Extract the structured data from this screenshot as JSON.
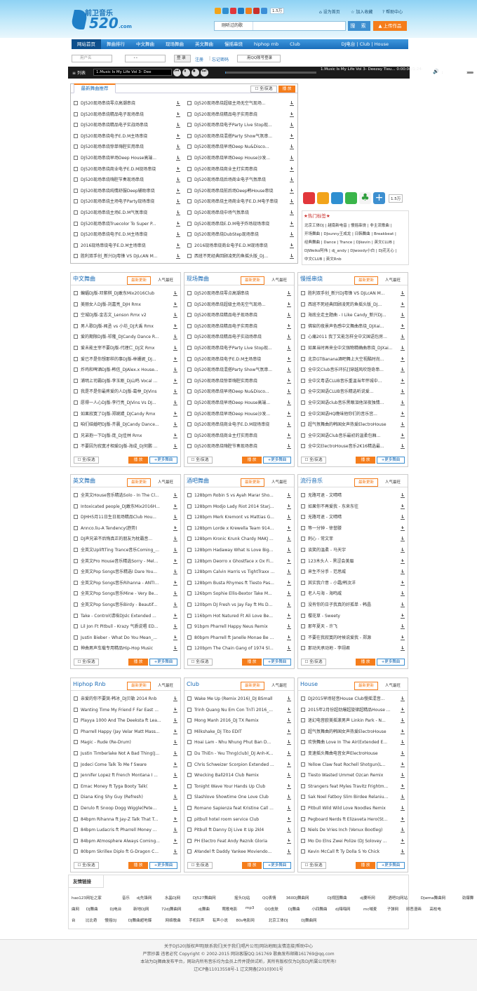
{
  "header": {
    "logo_cn": "前卫音乐",
    "logo_num": "520",
    "logo_com": ".com",
    "count": "1.5万",
    "links": [
      "设为首页",
      "加入收藏",
      "帮助中心"
    ],
    "search_select": "刚听过的歌",
    "search_placeholder": "",
    "search_btn": "搜 索",
    "upload_btn": "上传作品"
  },
  "nav": {
    "items": [
      "网站首页",
      "舞曲排行",
      "中文舞曲",
      "现场舞曲",
      "英文舞曲",
      "慢摇串烧",
      "hiphop rnb",
      "Club"
    ],
    "right": "DJ电台 | Club | House"
  },
  "login": {
    "user_placeholder": "用户名",
    "pass_placeholder": "••",
    "login_btn": "登 录",
    "register": "注册",
    "forgot": "忘记密码",
    "qq": "用QQ账号登录"
  },
  "player": {
    "list": "列表",
    "song": "1.Music Is My Life Vol 3- Dee",
    "now": "1.Music Is My Life Vol 3- Deezay Tieu... 0:00:04/1:24:48"
  },
  "recommend": {
    "tab": "最新舞曲推荐",
    "select_all": "全/反选",
    "play": "播 放",
    "left": [
      "DJ520现场串烧零点高潮串烧",
      "DJ520现场串烧精品电子现场串烧",
      "DJ520现场串烧精品电子实战场串烧",
      "DJ520现场串烧电子E.D.M主场串烧",
      "DJ520现场串烧惊单嗨腔实用串烧",
      "DJ520现场串烧早场Deep House高端...",
      "DJ520现场串烧商业电子E.D.M现场串烧",
      "DJ520现场串烧嗨腔节奏现场串烧",
      "DJ520现场串烧纯情舒服Deep辅助串烧",
      "DJ520现场串烧主场电子Party现场串烧",
      "DJ520现场串烧主场E.D.M气氛串烧",
      "DJ520现场串烧Truecolor To Super P...",
      "DJ520现场串烧电子E.D.M主场串烧",
      "2016现场串烧电子E.D.M主场串烧",
      "胜利双手创_新兴DJ粤锋 VS DJLcAN M..."
    ],
    "right": [
      "DJ520现场串烧超级主场无空气现场...",
      "DJ520现场串烧精品电子实用串烧",
      "DJ520现场串烧电子Party Live Stop现...",
      "DJ520现场串烧混搭Party Show气氛串...",
      "DJ520现场串烧早场Deep Nu&Disco...",
      "DJ520现场串烧早场Deep House沙发...",
      "DJ520现场串烧商业主打实用串烧",
      "DJ520现场串烧后场商业电子气氛串烧",
      "DJ520现场串烧前后场Deep韩House串烧",
      "DJ520现场串烧主场商业电子E.D.M电子串烧",
      "DJ520现场串烧中场气氛串烧",
      "DJ520现场串烧E.D.M电子炸场现场串烧",
      "DJ520现场串烧DubStep现场串烧",
      "2016现场串烧商业电子E.D.M现场串烧",
      "西班不死经典回顾凌死的鱼摇头版_DJ..."
    ]
  },
  "share": {
    "count": "1.5万"
  },
  "tags": {
    "title": "热门标签",
    "lines": [
      "北京工体DJ | 越南新电音 | 慢摇串烧 | 非主流歌曲 |",
      "开场舞曲 | DJsunny王成龙 | 日韩舞曲 | Breakbeat |",
      "经典舞曲 | Dance | Trance | DJkevin | 英文CLUB |",
      "DJWeiko阿伟 | dj_andy | DJwoody小白 | DJ花无心 |",
      "中文CLUB | 英文Rnb"
    ]
  },
  "sections": [
    {
      "title": "中文舞曲",
      "new": "最新更新",
      "hot": "人气最旺",
      "items": [
        "蝙蝠DJ版-邓紫棋_DJ敢东Mix2016Club",
        "美丽女人DJ版-刘嘉亮_DJH Rmx",
        "空城DJ版-金志文_Lenson Rmx v2",
        "男人歌DJ版-闻丞 vs 小坊_DJ大禹 Rmx",
        "爱的期限DJ版-祁隆_DJCandy Dance R...",
        "爱未能主宰不要DJ版-代理仁_DJ文 Rmx",
        "爱已不是你想那样的事DJ版-林姗妮_DJ...",
        "炸鸡和啤酒DJ版-韩信_DJAlex.x House...",
        "浦明上司霸DJ版-李玉刚_Dj山鸣 Vocal ...",
        "我是不是你最疼爱的人DJ版-葛林_DJVins",
        "愿得一人心DJ版-李行亮_DJVins Vs DJ...",
        "如果寂寞了DJ版-郑婉婧_DJCandy Rmx",
        "咱们结婚吧DJ版-齐晨_DJCandy Dance...",
        "兄弟抱一下DJ版-庞_DJ佳林 Rmx",
        "不要因为寂寞才相爱DJ版-海成_DJ何鹏 ..."
      ]
    },
    {
      "title": "现场舞曲",
      "new": "最新更新",
      "hot": "人气最旺",
      "items": [
        "DJ520现场串烧零点高潮串烧",
        "DJ520现场串烧超级主场无空气现场...",
        "DJ520现场串烧精品电子现场串烧",
        "DJ520现场串烧精品电子实用串烧",
        "DJ520现场串烧精品电子实战场串烧",
        "DJ520现场串烧电子Party Live Stop现...",
        "DJ520现场串烧电子E.D.M主场串烧",
        "DJ520现场串烧混搭Party Show气氛串...",
        "DJ520现场串烧惊单嗨腔实用串烧",
        "DJ520现场串烧早场Deep Nu&Disco...",
        "DJ520现场串烧早场Deep House高端...",
        "DJ520现场串烧早场Deep House沙发...",
        "DJ520现场串烧商业电子E.D.M现场串烧",
        "DJ520现场串烧商业主打实用串烧",
        "DJ520现场串烧嗨腔节奏现场串烧"
      ]
    },
    {
      "title": "慢摇串烧",
      "new": "最新更新",
      "hot": "人气最旺",
      "items": [
        "胜利双手创_新兴DJ粤锋 VS DJLcAN M...",
        "西班不死经典回顾凌死的鱼摇头版_DJ...",
        "海底全走主题曲 - I Like Candy_新兴DJ...",
        "佛窑的夜景声色感中文舞曲串烧_DJXai...",
        "心痛2011 我丁又能怎样全中文国语包房...",
        "如果当时再来全中文强物精确曲串烧_DJXai...",
        "北京GTBanana酒吧舞上大空视酷时尚...",
        "全中文Club音乐环抗[]穿越风吹饱奇串...",
        "全中文粤语CLUB音乐重温当年怀城中...",
        "全中文国语CLUB音乐精选听说爱...",
        "全中文国语club音乐黑眼泪他深夜独情...",
        "全中文国语HQ晚味他你们的音乐宫...",
        "超气氛舞曲的韩国女声热爱ElectroHouse",
        "全中文国语Club音乐最初的温柔包厢...",
        "全中文ElectroHouse音乐2K16精选最..."
      ]
    },
    {
      "title": "英文舞曲",
      "new": "最新更新",
      "hot": "人气最旺",
      "items": [
        "全英文House音乐精选Solo - In The Cl...",
        "Intoxicated people_DJ敢东Mix2016H...",
        "DJHH5月11日生日现场精品Club Hou...",
        "Annco.liu-A Tendency(趋势)",
        "DJ声兄弟不后悔真正的朋友为枕霸音...",
        "全英文UpliftTing Trance音乐Coming_...",
        "全英文Pro House音乐精选Sorry - Mel...",
        "全英文Pop Songs音乐精选I Dare You...",
        "全英文Pop Songs音乐Rihanna - ANTI...",
        "全英文Pop Songs音乐Mine - Very Be...",
        "全英文Pop Songs音乐Birdy - Beautif...",
        "Take - Control(请埃DJslc Extended ...",
        "Lil Jon Ft Pitbull - Krazy 气质说唱 ED...",
        "Justin Bieber - What Do You Mean_...",
        "神曲男声车载专用精品Hip-Hop Music"
      ]
    },
    {
      "title": "酒吧舞曲",
      "new": "最新更新",
      "hot": "人气最旺",
      "items": [
        "128bpm Robin S vs Ayah Marar Sho...",
        "128bpm Modjo Lady Riot 2014 Starj...",
        "128bpm Merk Kremont vs Mattias G...",
        "128bpm Lorde x Krewella Team 914...",
        "128bpm Kronic Krunk Chardy MAKJ ...",
        "128bpm Hadaway What Is Love Big...",
        "128bpm Deorro x Ghostface x Ox Fi...",
        "128bpm Calvin Harris vs TightTraxx ...",
        "128bpm Busta Rhymes ft Tiesto Pas...",
        "126bpm Sophie Ellis-Bextor Take M...",
        "120bpm DJ Fresh vs Jay Fay ft Ms D...",
        "116bpm Hot Natured Ft Ali Love Be...",
        "91bpm Pharrell Happy Neus Remix",
        "80bpm Pharrell ft Janelle Monae Be ...",
        "120bpm The Chain Gang of 1974 Sl..."
      ]
    },
    {
      "title": "流行音乐",
      "new": "最新更新",
      "hot": "人气最旺",
      "items": [
        "无路可退 - 文晴晴",
        "如果你不再爱我 - 东来东往",
        "无路可退 - 文晴晴",
        "等一分钟 - 徐誉滕",
        "刺心 - 常文菲",
        "谈笑的温柔 - 马天宇",
        "123木头人 - 黑涩会美眉",
        "来生不分手 - 范思威",
        "其实我介意 - 小霜/韩汶洋",
        "老人与海 - 海鸣威",
        "没有你的日子我真的好孤单 - 韩晶",
        "樱花草 - Sweety",
        "那年夏天 - 许飞",
        "不要在我寂寞的时候说爱我 - 郑源",
        "那动天承动地 - 李翊君"
      ]
    },
    {
      "title": "Hiphop Rnb",
      "new": "最新更新",
      "hot": "人气最旺",
      "items": [
        "亲爱的你不要哭-韩冰_DJ贝勒 2014 Rnb",
        "Wanting Time My Friend F Far East ...",
        "Playya 1000 And The Deeksta ft Lea...",
        "Pharrell Happy (Jay Velar Matt Mass...",
        "Magic - Rude (Re-Drum)",
        "Justin Timberlake Not A Bad Thing(J...",
        "Jodeci Come Talk To Me f Sware",
        "Jennifer Lopez ft French Montana I ...",
        "Emac Money ft Tyga Booty Talk(",
        "Diana King Shy Guy (Refresh)",
        "Derulo ft Snoop Dogg Wiggle(Pete...",
        "84bpm Rihanna ft Jay-Z Talk That T...",
        "84bpm Ludacris ft Pharrell Money ...",
        "84bpm Atmosphere Always Coming...",
        "80bpm Skrillex Diplo ft G-Dragon C..."
      ]
    },
    {
      "title": "Club",
      "new": "最新更新",
      "hot": "人气最旺",
      "items": [
        "Wake Me Up (Remix 2016)_DJ BSmall",
        "Trinh Quang Nu Em Con TnTi 2016_...",
        "Mong Manh 2016_DJ TX Remix",
        "Milkshake_Dj Tito EDIT",
        "Hoai Lam - Nhu Nhung Phut Ban D...",
        "Du ThiEn - Yeu Thng(club)_DJ Anh-K...",
        "Chris Schweizer Scorpion Extended ...",
        "Wrecking Ball2014 Club Remix",
        "Tonight Wave Your Hands Up Club",
        "Slashlove Showtime One Love Club",
        "Romano Sapienza feat Kristine Call ...",
        "pitbull hotel room service Club",
        "Pitbull ft Danny Dj Live It Up 2kl4",
        "PH Electro Feat Andy Reznik Gloria",
        "AYandel ft Daddy Yankee Moviendo..."
      ]
    },
    {
      "title": "House",
      "new": "最新更新",
      "hot": "人气最旺",
      "items": [
        "DJ2015早场轻音House Club慢摇混音...",
        "2015年2月份超劲爆超旋律超精品House ...",
        "迷幻电音欧美摇滚男声 Linkin Park - N...",
        "超气氛舞曲的韩国女声热爱ElectroHouse",
        "欢快舞曲 Love In The Air(Extended E...",
        "变速摇头舞曲电音女声ElectroHouse",
        "Yellow Claw feat Rochell Shotgun(L...",
        "Tiesto Wasted Ummet Ozcan Remix",
        "Strangers feat Myles Travitz Frightm...",
        "Sak Noel Fatboy Slim Birdee Relaniu...",
        "Pitbull Wild Wild Love Noodles Remix",
        "Pegboard Nerds ft Elizaveta Hero(St...",
        "Niels De Vries Inch (Venux Bootleg)",
        "Mo Do Elns Zwei Polize (DJ Solovey ...",
        "Kevin McCall ft Ty Dolla S Yo Chick"
      ]
    }
  ],
  "sec_footer": {
    "select_all": "全/反选",
    "play": "播 放",
    "more": "更多舞曲"
  },
  "friend": {
    "title": "友情链接",
    "rows": [
      [
        "hao123网址之家",
        "音乐",
        "dj先锋网",
        "水晶DJ网",
        "DJ527舞曲网",
        "摇头DJ站",
        "QQ表情",
        "360DJ舞曲网",
        "DJ视园舞曲",
        "dj要听网",
        "酒吧DJ网站",
        "Djwma舞曲网",
        "劲爆舞"
      ],
      [
        "曲网",
        "DJ舞曲",
        "DJ电台",
        "新地DJ网",
        "72dj舞曲网",
        "dj舞曲",
        "莺歌电影",
        "mp3",
        "QQ皮肤",
        "DJ舞曲",
        "小四舞曲",
        "dj嗨嗨网",
        "mc喊麦",
        "子弹网",
        "邪恶漫画",
        "高校电"
      ],
      [
        "台",
        "比比奇",
        "慢摇DJ",
        "DJ舞曲超地爆",
        "网络歌曲",
        "手机铃声",
        "有声小说",
        "80s电影网",
        "北京工体DJ",
        "DJ舞曲网"
      ]
    ]
  },
  "footer": {
    "lines": [
      "关于DJ520|版权声明|联系我们|关于我们|唱片公司|网站地图|友情连接|帮助中心",
      "严禁抄袭 违者必究 Copyright © 2002-2015 网站客服QQ:161769 歌曲发布邮箱161769@qq.com",
      "本站为DJ舞曲发布平台，网站内所有音乐均为会员上传并提供试听，其所有版权仅为DJ及DJ所属公司所有!",
      "辽ICP备11013558号-1 辽文网备[2010]001号"
    ]
  }
}
